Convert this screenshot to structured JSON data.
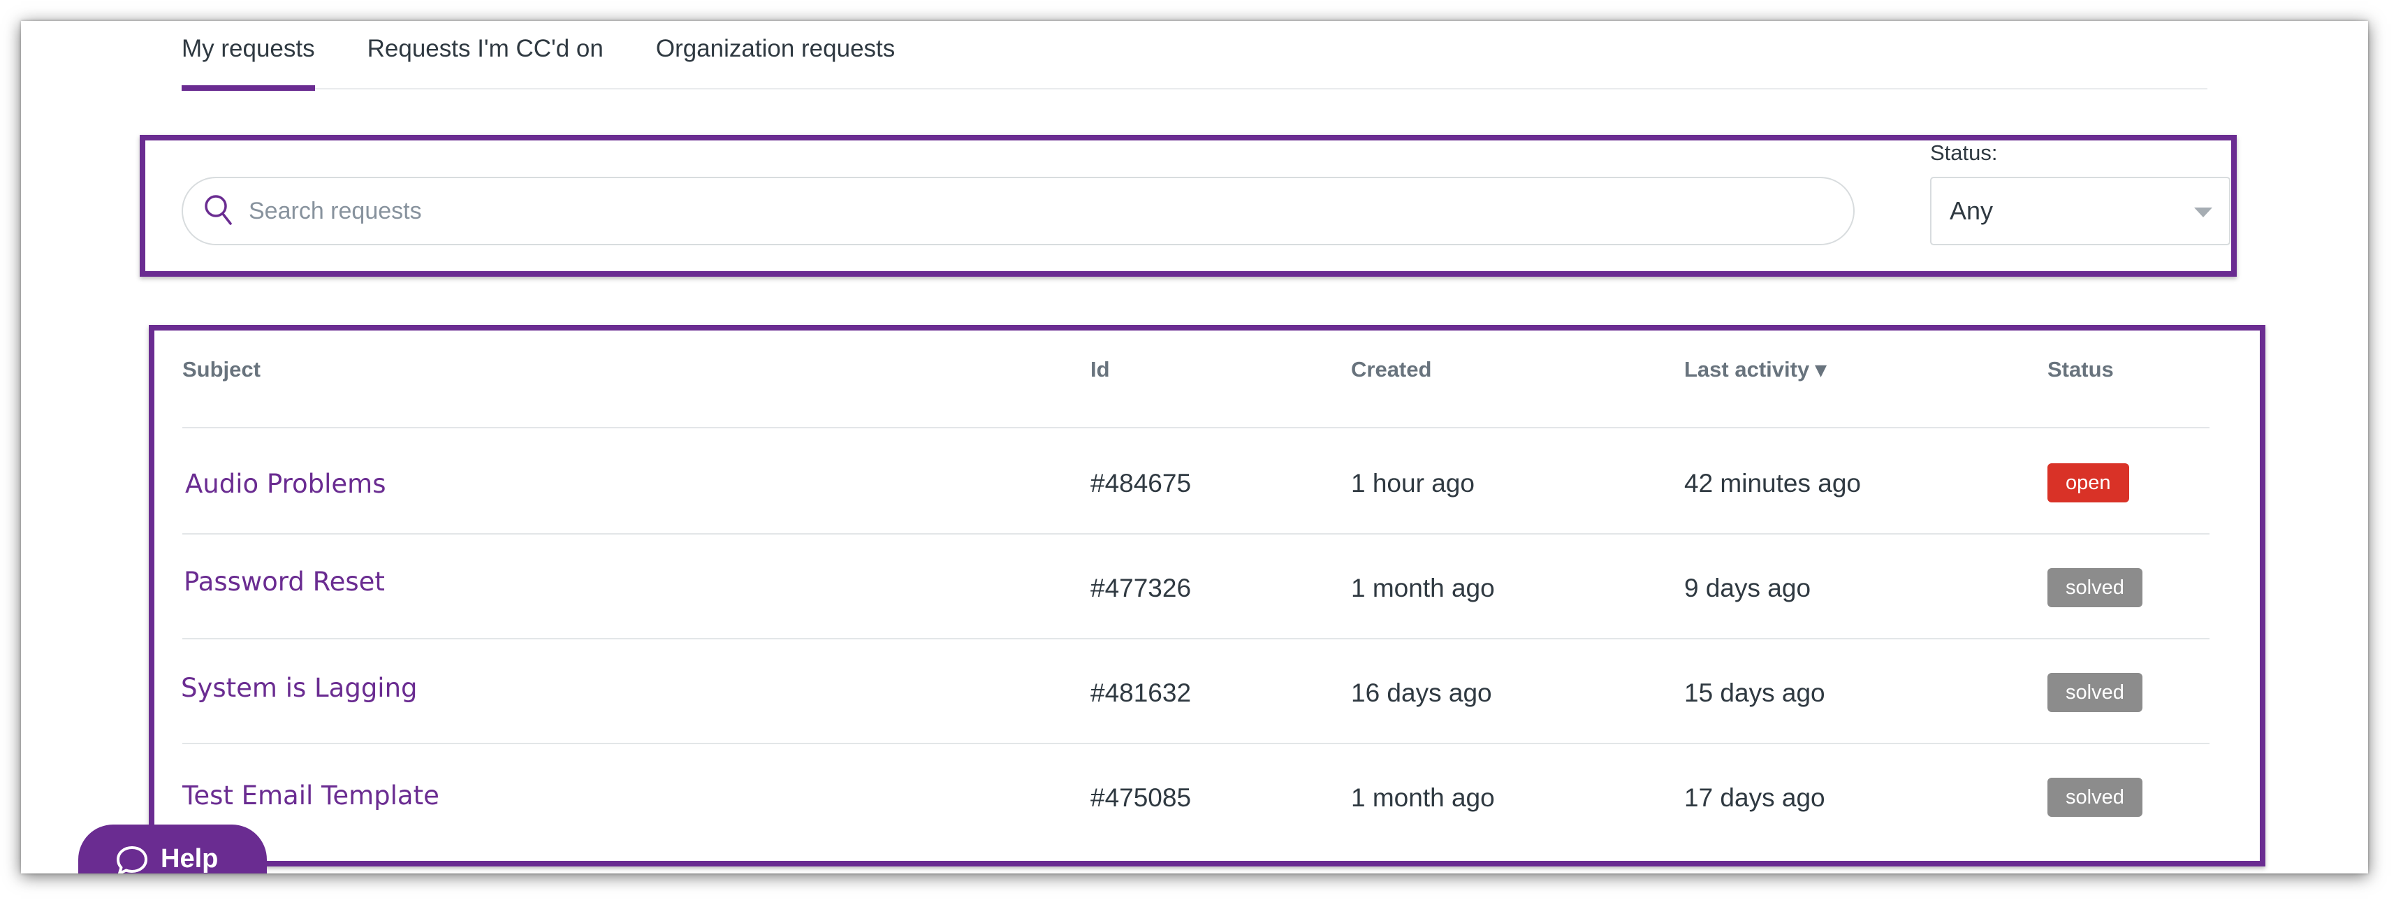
{
  "tabs": [
    {
      "label": "My requests",
      "active": true
    },
    {
      "label": "Requests I'm CC'd on",
      "active": false
    },
    {
      "label": "Organization requests",
      "active": false
    }
  ],
  "search": {
    "placeholder": "Search requests",
    "value": ""
  },
  "status_filter": {
    "label": "Status:",
    "selected": "Any"
  },
  "table": {
    "columns": [
      "Subject",
      "Id",
      "Created",
      "Last activity ▾",
      "Status"
    ],
    "rows": [
      {
        "subject": "Audio Problems",
        "id": "#484675",
        "created": "1 hour ago",
        "last_activity": "42 minutes ago",
        "status": "open"
      },
      {
        "subject": "Password Reset",
        "id": "#477326",
        "created": "1 month ago",
        "last_activity": "9 days ago",
        "status": "solved"
      },
      {
        "subject": "System is Lagging",
        "id": "#481632",
        "created": "16 days ago",
        "last_activity": "15 days ago",
        "status": "solved"
      },
      {
        "subject": "Test Email Template",
        "id": "#475085",
        "created": "1 month ago",
        "last_activity": "17 days ago",
        "status": "solved"
      }
    ]
  },
  "help": {
    "label": "Help",
    "icon": "chat-bubble-icon"
  },
  "colors": {
    "accent": "#6a2c91",
    "open": "#d93227",
    "solved": "#8c8c8c"
  }
}
